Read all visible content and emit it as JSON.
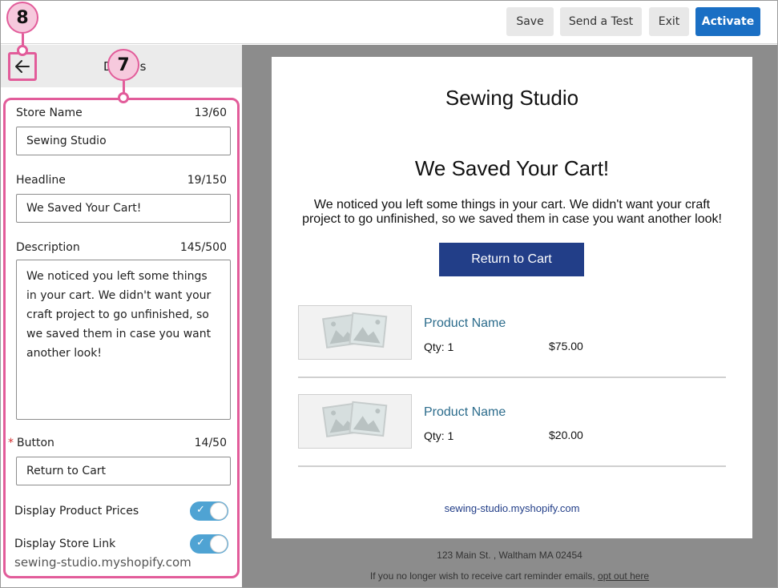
{
  "toolbar": {
    "save_label": "Save",
    "send_test_label": "Send a Test",
    "exit_label": "Exit",
    "activate_label": "Activate",
    "activate_color": "#1a6fc4"
  },
  "panel": {
    "title": "D",
    "title_tail": "s",
    "back_icon": "arrow-left-icon"
  },
  "form": {
    "store_name": {
      "label": "Store Name",
      "count": "13/60",
      "value": "Sewing Studio"
    },
    "headline": {
      "label": "Headline",
      "count": "19/150",
      "value": "We Saved Your Cart!"
    },
    "description": {
      "label": "Description",
      "count": "145/500",
      "value": "We noticed you left some things in your cart. We didn't want your craft project to go unfinished, so we saved them in case you want another look!"
    },
    "button": {
      "required_mark": "*",
      "label": "Button",
      "count": "14/50",
      "value": "Return to Cart"
    },
    "display_prices": {
      "label": "Display Product Prices",
      "on": true
    },
    "display_store_link": {
      "label": "Display Store Link",
      "on": true
    },
    "store_link": "sewing-studio.myshopify.com"
  },
  "markers": {
    "back": "8",
    "form": "7",
    "color": "#e25c9a"
  },
  "email": {
    "store_name": "Sewing Studio",
    "headline": "We Saved Your Cart!",
    "description": "We noticed you left some things in your cart. We didn't want your craft project to go unfinished, so we saved them in case you want another look!",
    "button_label": "Return to Cart",
    "button_color": "#223e88",
    "products": [
      {
        "name": "Product Name",
        "qty": "Qty: 1",
        "price": "$75.00"
      },
      {
        "name": "Product Name",
        "qty": "Qty: 1",
        "price": "$20.00"
      }
    ],
    "store_link": "sewing-studio.myshopify.com",
    "address": "123 Main St. , Waltham MA 02454",
    "unsub_text": "If you no longer wish to receive cart reminder emails,",
    "unsub_link": "opt out here"
  }
}
